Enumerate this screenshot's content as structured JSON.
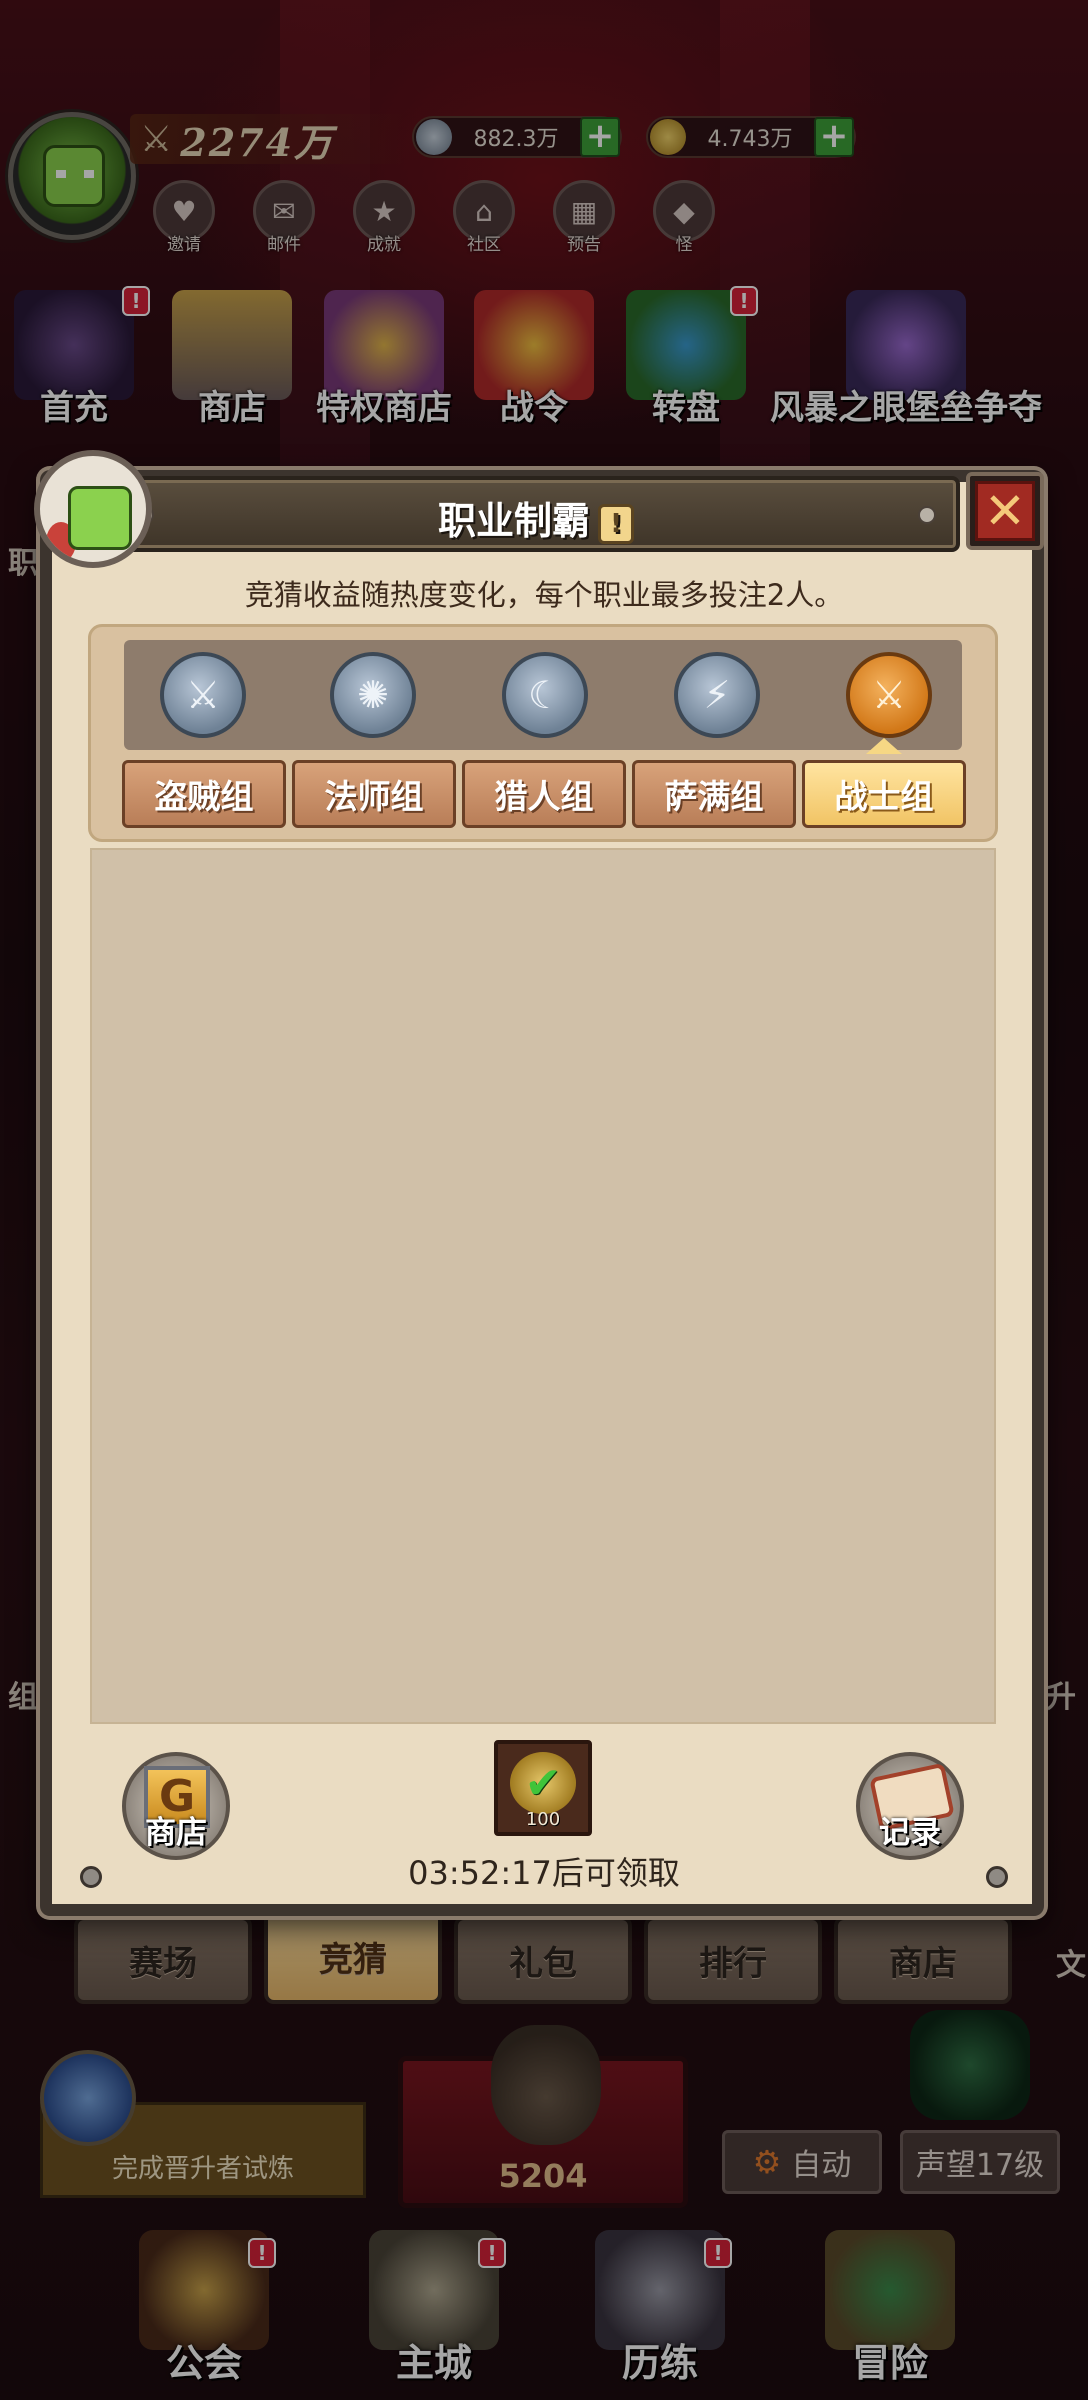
{
  "header": {
    "power_value": "2274万",
    "currency_silver": "882.3万",
    "currency_gold": "4.743万"
  },
  "shortcuts": [
    {
      "label": "邀请",
      "icon": "heart-envelope-icon"
    },
    {
      "label": "邮件",
      "icon": "mail-icon"
    },
    {
      "label": "成就",
      "icon": "achievement-icon"
    },
    {
      "label": "社区",
      "icon": "home-icon"
    },
    {
      "label": "预告",
      "icon": "calendar-icon"
    },
    {
      "label": "怪",
      "icon": "monster-icon"
    }
  ],
  "features": [
    {
      "label": "首充",
      "badge": "!"
    },
    {
      "label": "商店",
      "badge": ""
    },
    {
      "label": "特权商店",
      "badge": ""
    },
    {
      "label": "战令",
      "badge": ""
    },
    {
      "label": "转盘",
      "badge": "!"
    },
    {
      "label": "风暴之眼堡垒争夺",
      "badge": ""
    }
  ],
  "side": {
    "left_top": "职",
    "left_mid": "组",
    "right_mid": "升",
    "right_low": "文"
  },
  "modal": {
    "title": "职业制霸",
    "info_glyph": "!",
    "close_glyph": "✕",
    "description": "竞猜收益随热度变化，每个职业最多投注2人。",
    "class_icons": [
      {
        "name": "rogue-icon",
        "glyph": "⚔"
      },
      {
        "name": "mage-icon",
        "glyph": "✺"
      },
      {
        "name": "hunter-icon",
        "glyph": "☾"
      },
      {
        "name": "shaman-icon",
        "glyph": "⚡"
      },
      {
        "name": "warrior-icon",
        "glyph": "⚔"
      }
    ],
    "class_tabs": [
      "盗贼组",
      "法师组",
      "猎人组",
      "萨满组",
      "战士组"
    ],
    "active_tab_index": 4,
    "shop_label": "商店",
    "shop_glyph": "G",
    "record_label": "记录",
    "reward_qty": "100",
    "reward_check": "✔",
    "timer_text": "03:52:17后可领取"
  },
  "bottom_tabs": [
    "赛场",
    "竞猜",
    "礼包",
    "排行",
    "商店"
  ],
  "bottom_active_index": 1,
  "trial_label": "完成晋升者试炼",
  "bag_count": "5204",
  "auto_label": "自动",
  "auto_glyph": "⚙",
  "fame_label": "声望17级",
  "navbar": [
    {
      "label": "公会",
      "badge": "!"
    },
    {
      "label": "主城",
      "badge": "!"
    },
    {
      "label": "历练",
      "badge": "!"
    },
    {
      "label": "冒险",
      "badge": ""
    }
  ],
  "colors": {
    "accent_gold": "#f1c465",
    "badge_red": "#d8233a",
    "plus_green": "#3ea13a",
    "modal_bg": "#eadcc2"
  }
}
